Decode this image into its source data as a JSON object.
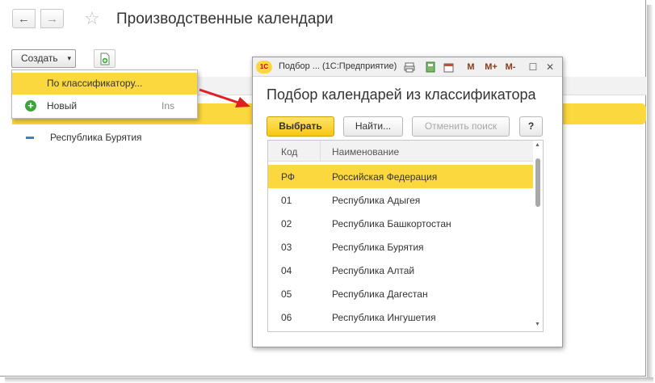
{
  "main": {
    "title": "Производственные календари",
    "nav_back": "←",
    "nav_forward": "→",
    "favorite_icon": "☆",
    "create_label": "Создать",
    "create_caret": "▾",
    "list": [
      {
        "label": "Республика Бурятия"
      }
    ]
  },
  "dropdown": {
    "items": [
      {
        "label": "По классификатору...",
        "shortcut": ""
      },
      {
        "label": "Новый",
        "shortcut": "Ins"
      }
    ]
  },
  "modal": {
    "window_title": "Подбор ... (1С:Предприятие)",
    "logo": "1С",
    "toolbar": {
      "m": "M",
      "m_plus": "M+",
      "m_minus": "M-",
      "maximize": "☐",
      "close": "✕"
    },
    "heading": "Подбор календарей из классификатора",
    "buttons": {
      "select": "Выбрать",
      "find": "Найти...",
      "cancel_search": "Отменить поиск",
      "help": "?"
    },
    "columns": {
      "code": "Код",
      "name": "Наименование"
    },
    "rows": [
      {
        "code": "РФ",
        "name": "Российская Федерация"
      },
      {
        "code": "01",
        "name": "Республика Адыгея"
      },
      {
        "code": "02",
        "name": "Республика Башкортостан"
      },
      {
        "code": "03",
        "name": "Республика Бурятия"
      },
      {
        "code": "04",
        "name": "Республика Алтай"
      },
      {
        "code": "05",
        "name": "Республика Дагестан"
      },
      {
        "code": "06",
        "name": "Республика Ингушетия"
      }
    ]
  },
  "colors": {
    "accent": "#fbd83d",
    "arrow": "#e02020"
  }
}
